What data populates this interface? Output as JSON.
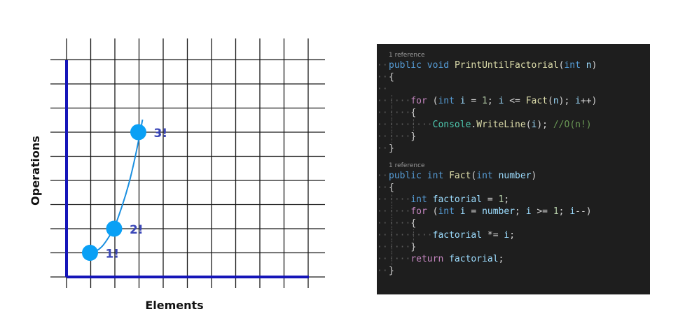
{
  "colors": {
    "grid": "#1a1a1a",
    "axis": "#1515b8",
    "curve": "#1a8fe0",
    "point": "#0aa0f5",
    "point_label": "#3b47b8",
    "code_bg": "#1e1e1e"
  },
  "chart_data": {
    "type": "line",
    "xlabel": "Elements",
    "ylabel": "Operations",
    "grid": true,
    "x": [
      1,
      2,
      3
    ],
    "y": [
      1,
      2,
      6
    ],
    "point_labels": [
      "1!",
      "2!",
      "3!"
    ],
    "series": [
      {
        "values": [
          1,
          2,
          6
        ]
      }
    ]
  },
  "code": {
    "reference_label": "1 reference",
    "lines": [
      {
        "kind": "ref",
        "indent": 0,
        "tokens": [
          {
            "t": "1 reference",
            "c": "ref"
          }
        ]
      },
      {
        "kind": "code",
        "indent": 0,
        "tokens": [
          {
            "t": "public",
            "c": "kw"
          },
          {
            "t": " ",
            "c": "op"
          },
          {
            "t": "void",
            "c": "kw"
          },
          {
            "t": " ",
            "c": "op"
          },
          {
            "t": "PrintUntilFactorial",
            "c": "fn"
          },
          {
            "t": "(",
            "c": "op"
          },
          {
            "t": "int",
            "c": "kw"
          },
          {
            "t": " ",
            "c": "op"
          },
          {
            "t": "n",
            "c": "var"
          },
          {
            "t": ")",
            "c": "op"
          }
        ]
      },
      {
        "kind": "code",
        "indent": 0,
        "tokens": [
          {
            "t": "{",
            "c": "op"
          }
        ]
      },
      {
        "kind": "code",
        "indent": 0,
        "tokens": []
      },
      {
        "kind": "code",
        "indent": 1,
        "tokens": [
          {
            "t": "for",
            "c": "ctl"
          },
          {
            "t": " (",
            "c": "op"
          },
          {
            "t": "int",
            "c": "kw"
          },
          {
            "t": " ",
            "c": "op"
          },
          {
            "t": "i",
            "c": "var"
          },
          {
            "t": " = ",
            "c": "op"
          },
          {
            "t": "1",
            "c": "num"
          },
          {
            "t": "; ",
            "c": "op"
          },
          {
            "t": "i",
            "c": "var"
          },
          {
            "t": " <= ",
            "c": "op"
          },
          {
            "t": "Fact",
            "c": "fn"
          },
          {
            "t": "(",
            "c": "op"
          },
          {
            "t": "n",
            "c": "var"
          },
          {
            "t": "); ",
            "c": "op"
          },
          {
            "t": "i",
            "c": "var"
          },
          {
            "t": "++)",
            "c": "op"
          }
        ]
      },
      {
        "kind": "code",
        "indent": 1,
        "tokens": [
          {
            "t": "{",
            "c": "op"
          }
        ]
      },
      {
        "kind": "code",
        "indent": 2,
        "tokens": [
          {
            "t": "Console",
            "c": "ty"
          },
          {
            "t": ".",
            "c": "op"
          },
          {
            "t": "WriteLine",
            "c": "fn"
          },
          {
            "t": "(",
            "c": "op"
          },
          {
            "t": "i",
            "c": "var"
          },
          {
            "t": "); ",
            "c": "op"
          },
          {
            "t": "//O(n!)",
            "c": "cm"
          }
        ]
      },
      {
        "kind": "code",
        "indent": 1,
        "tokens": [
          {
            "t": "}",
            "c": "op"
          }
        ]
      },
      {
        "kind": "code",
        "indent": 0,
        "tokens": [
          {
            "t": "}",
            "c": "op"
          }
        ]
      },
      {
        "kind": "gap",
        "indent": 0,
        "tokens": []
      },
      {
        "kind": "ref",
        "indent": 0,
        "tokens": [
          {
            "t": "1 reference",
            "c": "ref"
          }
        ]
      },
      {
        "kind": "code",
        "indent": 0,
        "tokens": [
          {
            "t": "public",
            "c": "kw"
          },
          {
            "t": " ",
            "c": "op"
          },
          {
            "t": "int",
            "c": "kw"
          },
          {
            "t": " ",
            "c": "op"
          },
          {
            "t": "Fact",
            "c": "fn"
          },
          {
            "t": "(",
            "c": "op"
          },
          {
            "t": "int",
            "c": "kw"
          },
          {
            "t": " ",
            "c": "op"
          },
          {
            "t": "number",
            "c": "var"
          },
          {
            "t": ")",
            "c": "op"
          }
        ]
      },
      {
        "kind": "code",
        "indent": 0,
        "tokens": [
          {
            "t": "{",
            "c": "op"
          }
        ]
      },
      {
        "kind": "code",
        "indent": 1,
        "tokens": [
          {
            "t": "int",
            "c": "kw"
          },
          {
            "t": " ",
            "c": "op"
          },
          {
            "t": "factorial",
            "c": "var"
          },
          {
            "t": " = ",
            "c": "op"
          },
          {
            "t": "1",
            "c": "num"
          },
          {
            "t": ";",
            "c": "op"
          }
        ]
      },
      {
        "kind": "code",
        "indent": 1,
        "tokens": [
          {
            "t": "for",
            "c": "ctl"
          },
          {
            "t": " (",
            "c": "op"
          },
          {
            "t": "int",
            "c": "kw"
          },
          {
            "t": " ",
            "c": "op"
          },
          {
            "t": "i",
            "c": "var"
          },
          {
            "t": " = ",
            "c": "op"
          },
          {
            "t": "number",
            "c": "var"
          },
          {
            "t": "; ",
            "c": "op"
          },
          {
            "t": "i",
            "c": "var"
          },
          {
            "t": " >= ",
            "c": "op"
          },
          {
            "t": "1",
            "c": "num"
          },
          {
            "t": "; ",
            "c": "op"
          },
          {
            "t": "i",
            "c": "var"
          },
          {
            "t": "--)",
            "c": "op"
          }
        ]
      },
      {
        "kind": "code",
        "indent": 1,
        "tokens": [
          {
            "t": "{",
            "c": "op"
          }
        ]
      },
      {
        "kind": "code",
        "indent": 2,
        "tokens": [
          {
            "t": "factorial",
            "c": "var"
          },
          {
            "t": " *= ",
            "c": "op"
          },
          {
            "t": "i",
            "c": "var"
          },
          {
            "t": ";",
            "c": "op"
          }
        ]
      },
      {
        "kind": "code",
        "indent": 1,
        "tokens": [
          {
            "t": "}",
            "c": "op"
          }
        ]
      },
      {
        "kind": "code",
        "indent": 1,
        "tokens": [
          {
            "t": "return",
            "c": "ctl"
          },
          {
            "t": " ",
            "c": "op"
          },
          {
            "t": "factorial",
            "c": "var"
          },
          {
            "t": ";",
            "c": "op"
          }
        ]
      },
      {
        "kind": "code",
        "indent": 0,
        "tokens": [
          {
            "t": "}",
            "c": "op"
          }
        ]
      }
    ]
  }
}
